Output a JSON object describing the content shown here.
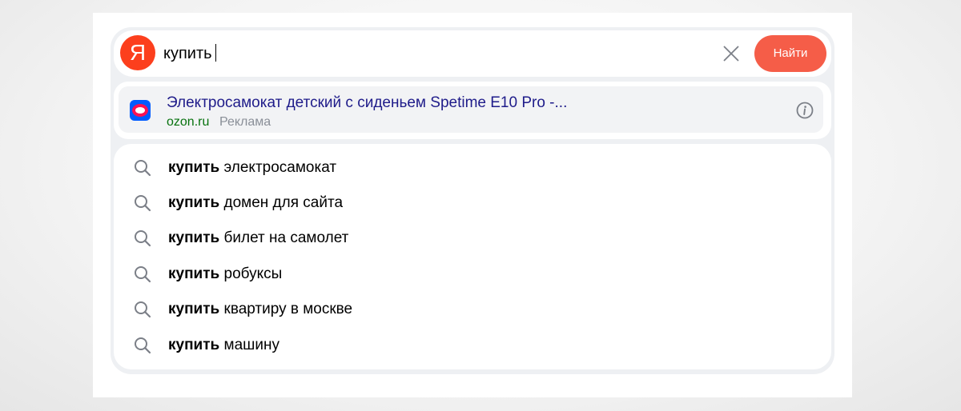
{
  "search": {
    "logo_letter": "Я",
    "query": "купить",
    "button_label": "Найти"
  },
  "ad": {
    "title": "Электросамокат детский с сиденьем Spetime E10 Pro -...",
    "domain": "ozon.ru",
    "label": "Реклама"
  },
  "suggestions": [
    {
      "bold": "купить",
      "rest": "электросамокат"
    },
    {
      "bold": "купить",
      "rest": "домен для сайта"
    },
    {
      "bold": "купить",
      "rest": "билет на самолет"
    },
    {
      "bold": "купить",
      "rest": "робуксы"
    },
    {
      "bold": "купить",
      "rest": "квартиру в москве"
    },
    {
      "bold": "купить",
      "rest": "машину"
    }
  ],
  "colors": {
    "brand": "#fc3f1d",
    "button": "#f55d48",
    "ad_title": "#1f1c8a",
    "ad_domain": "#07720e"
  },
  "icons": {
    "logo": "yandex-logo",
    "clear": "close-icon",
    "info": "info-icon",
    "suggest": "search-icon"
  }
}
